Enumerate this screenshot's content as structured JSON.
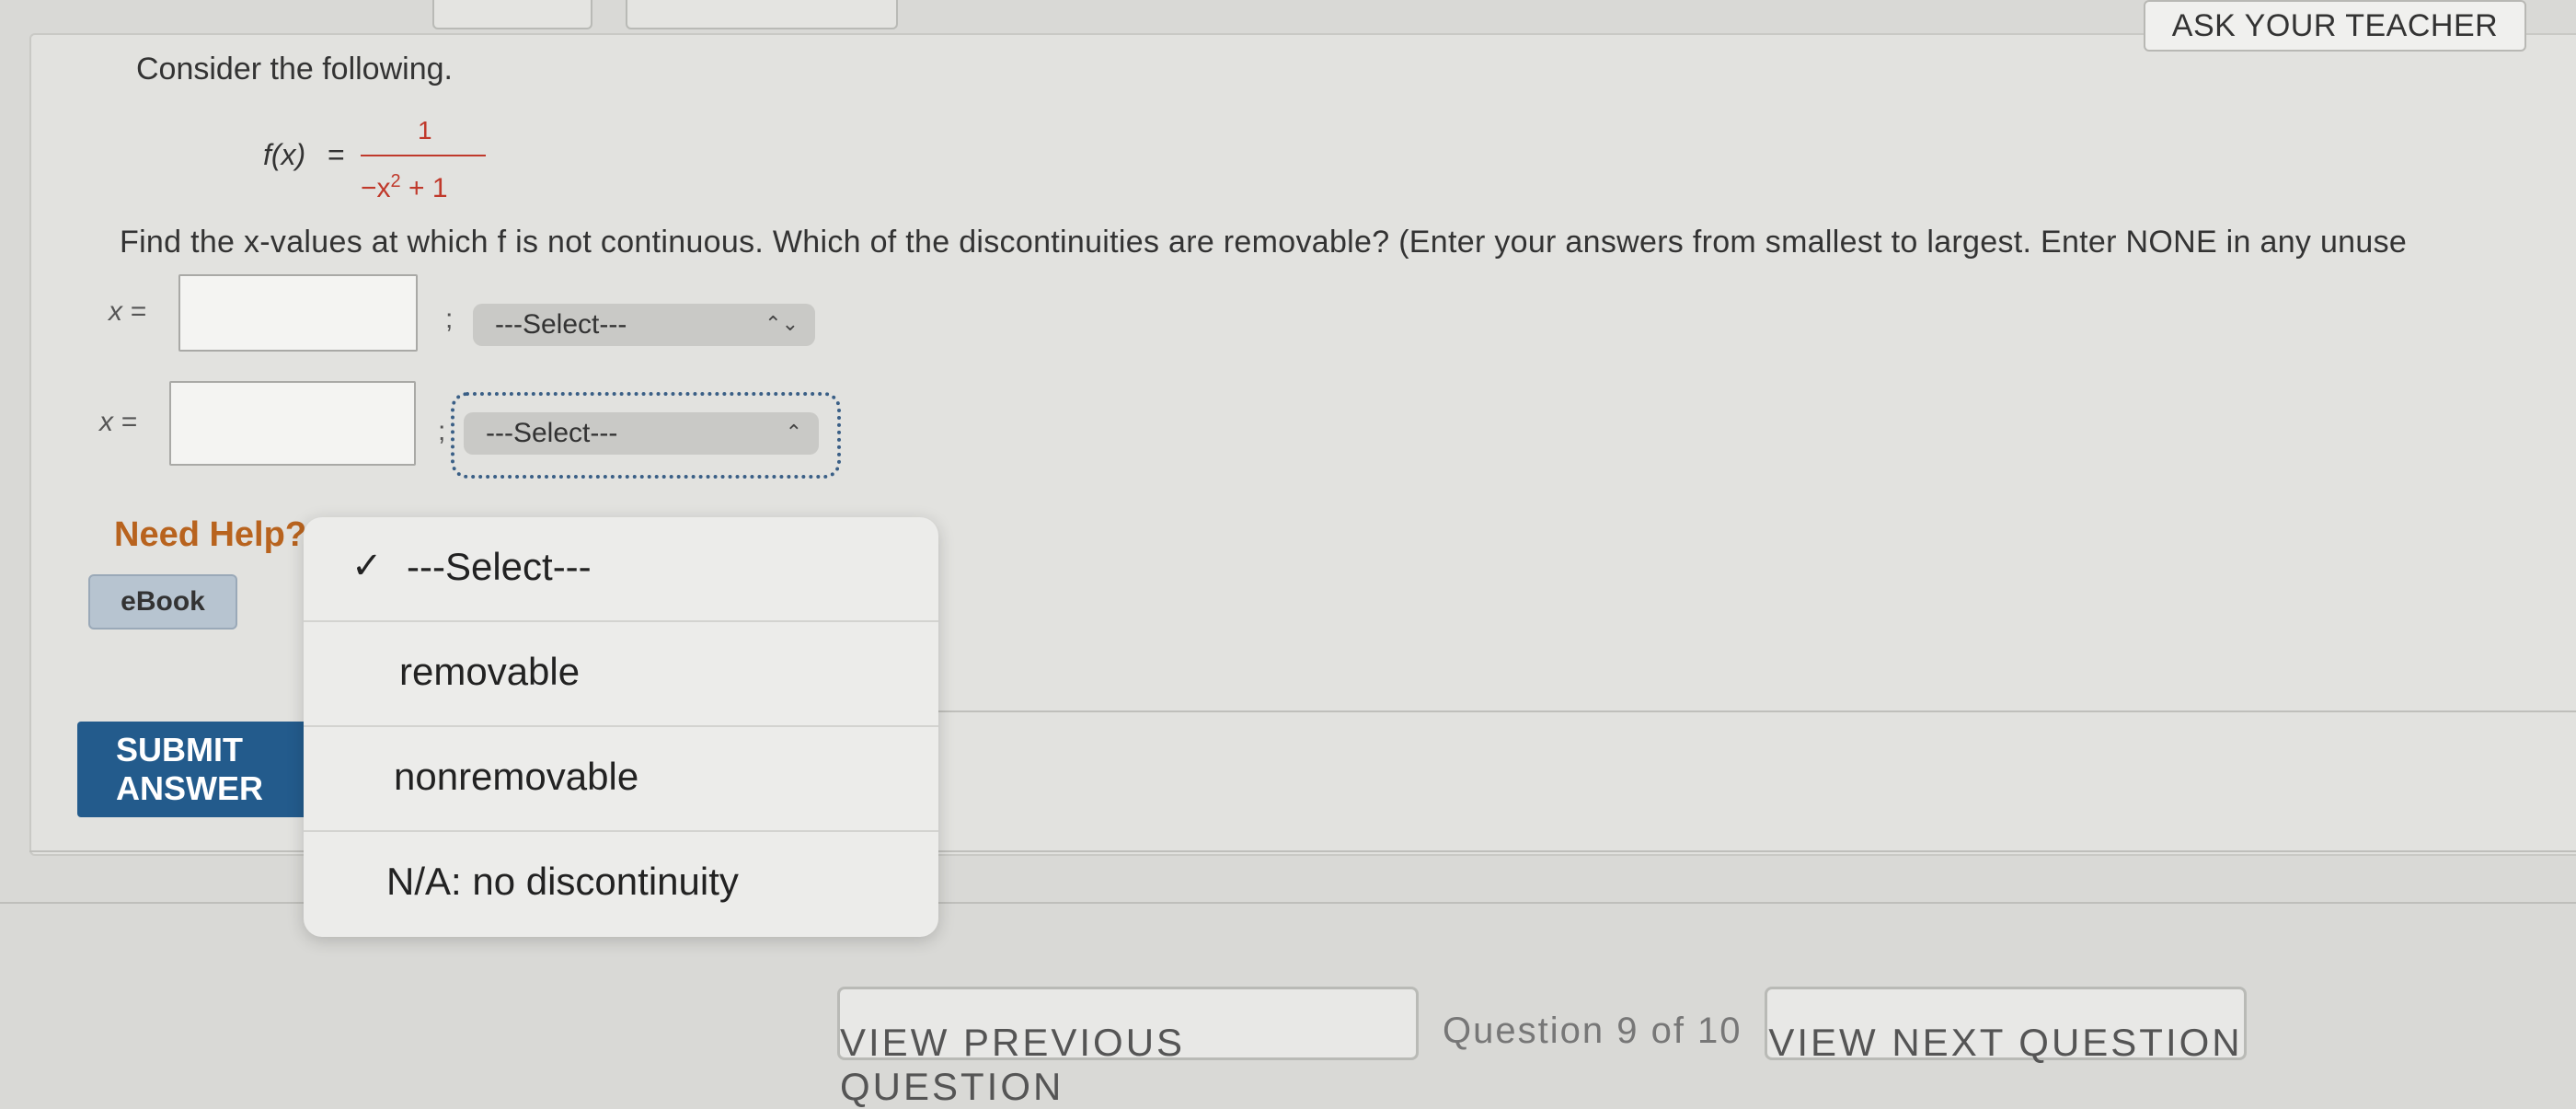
{
  "header": {
    "ask_teacher_label": "ASK YOUR TEACHER"
  },
  "problem": {
    "prompt": "Consider the following.",
    "function_lhs": "f(x)",
    "equals": "=",
    "numerator": "1",
    "denominator_base": "−x",
    "denominator_exp": "2",
    "denominator_rest": " + 1",
    "instructions": "Find the x-values at which f is not continuous. Which of the discontinuities are removable? (Enter your answers from smallest to largest. Enter NONE in any unuse"
  },
  "answers": [
    {
      "label": "x =",
      "value": "",
      "separator": ";",
      "select_value": "---Select---"
    },
    {
      "label": "x =",
      "value": "",
      "separator": ";",
      "select_value": "---Select---"
    }
  ],
  "help": {
    "heading": "Need Help?",
    "ebook_label": "eBook"
  },
  "submit_label": "SUBMIT ANSWER",
  "dropdown": {
    "selected_mark": "✓",
    "options": [
      "---Select---",
      "removable",
      "nonremovable",
      "N/A: no discontinuity"
    ]
  },
  "footer": {
    "prev_label": "VIEW PREVIOUS QUESTION",
    "question_counter": "Question 9 of 10",
    "next_label": "VIEW NEXT QUESTION"
  },
  "colors": {
    "accent_blue": "#235b8c",
    "help_orange": "#b8631e",
    "fraction_red": "#c0392b"
  }
}
